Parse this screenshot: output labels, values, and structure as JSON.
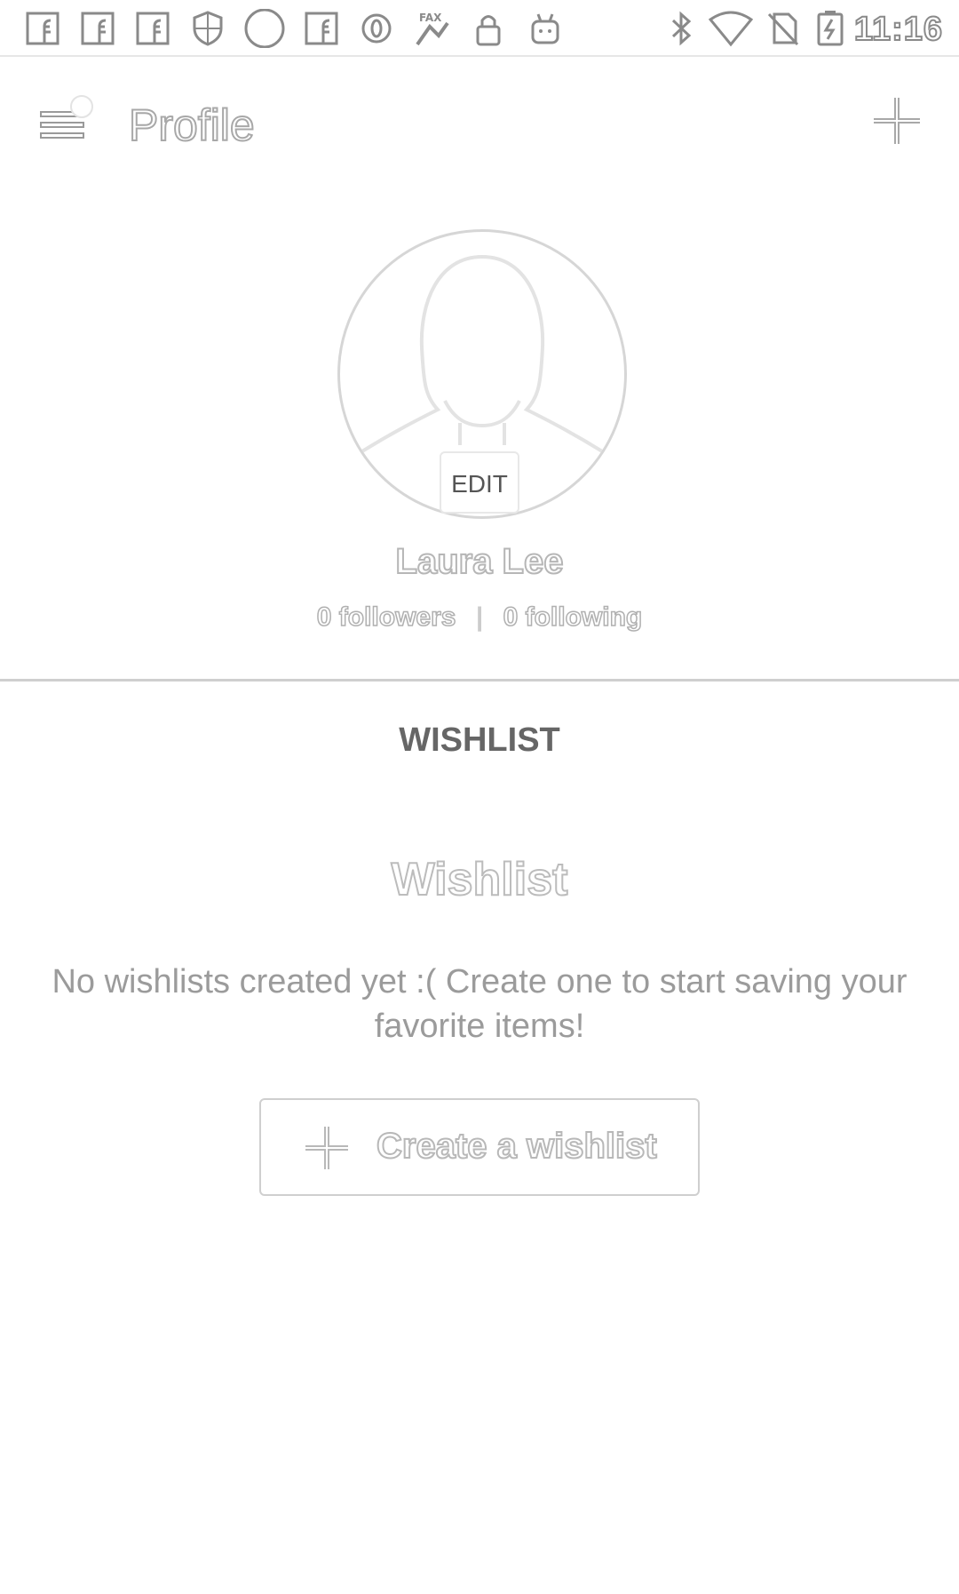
{
  "status_bar": {
    "time": "11:16",
    "left_icons": [
      "facebook-icon",
      "facebook-icon",
      "facebook-icon",
      "shield-icon",
      "circle-icon",
      "facebook-icon",
      "opera-icon",
      "fax-icon",
      "lock-icon",
      "android-icon"
    ],
    "right_icons": [
      "bluetooth-icon",
      "wifi-icon",
      "no-sim-icon",
      "battery-charging-icon"
    ]
  },
  "app_bar": {
    "title": "Profile",
    "menu_icon": "hamburger-menu-icon",
    "action_icon": "plus-icon"
  },
  "profile": {
    "name": "Laura Lee",
    "edit_label": "EDIT",
    "followers": "0 followers",
    "separator": "|",
    "following": "0 following"
  },
  "tabs": {
    "wishlist_label": "WISHLIST"
  },
  "wishlist": {
    "title": "Wishlist",
    "empty_message": "No wishlists created yet :( Create one to start saving your favorite items!",
    "create_button_label": "Create a wishlist"
  }
}
